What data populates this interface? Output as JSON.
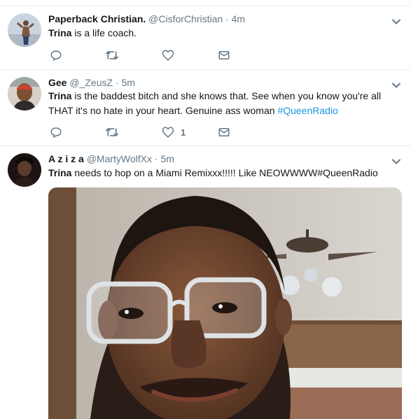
{
  "tweets": [
    {
      "name": "Paperback Christian.",
      "handle": "@CisforChristian",
      "time": "· 4m",
      "text_bold": "Trina",
      "text": " is a life coach.",
      "hashtag": "",
      "likes": ""
    },
    {
      "name": "Gee",
      "handle": "@_ZeusZ",
      "time": "· 5m",
      "text_bold": "Trina",
      "text": " is the baddest bitch and she knows that. See when you know you're all THAT it's no hate in your heart. Genuine ass woman ",
      "hashtag": "#QueenRadio",
      "likes": "1"
    },
    {
      "name": "A z i z a",
      "handle": "@MartyWolfXx",
      "time": "· 5m",
      "text_bold": "Trina",
      "text": " needs to hop on a Miami Remixxx!!!!! Like NEOWWWW#QueenRadio",
      "hashtag": "",
      "likes": ""
    }
  ],
  "icons": [
    "reply-icon",
    "retweet-icon",
    "like-icon",
    "dm-icon",
    "chevron-down-icon"
  ],
  "colors": {
    "link": "#1b95e0",
    "muted": "#657786",
    "border": "#e6ecf0"
  }
}
